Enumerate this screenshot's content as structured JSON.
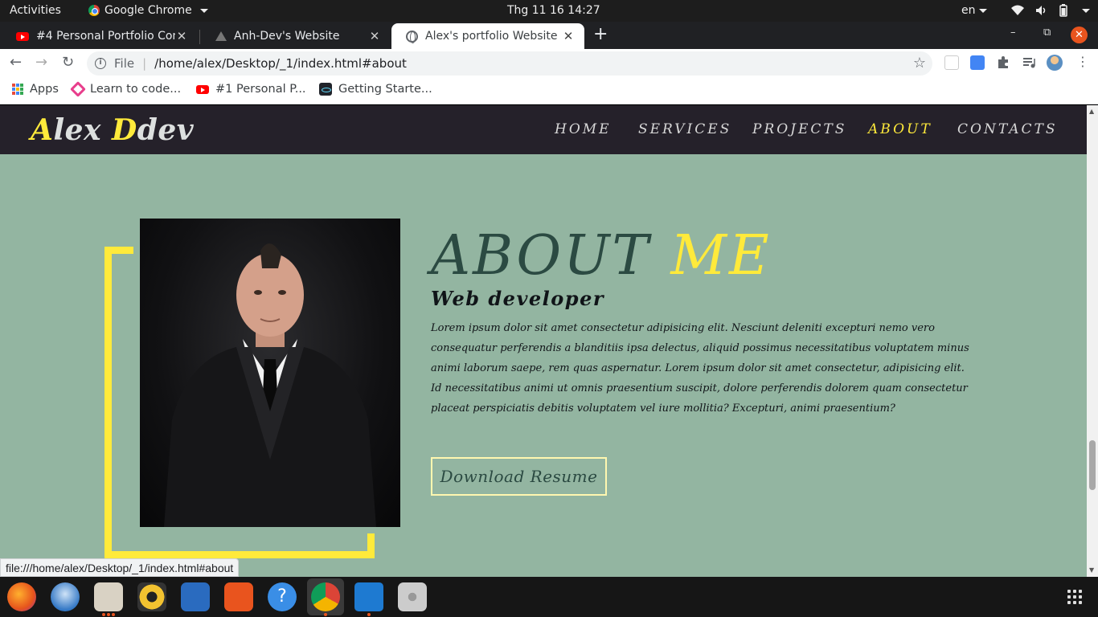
{
  "system": {
    "activities": "Activities",
    "app_name": "Google Chrome",
    "clock": "Thg 11 16  14:27",
    "lang": "en"
  },
  "tabs": [
    {
      "title": "#4 Personal Portfolio Con",
      "icon": "youtube-icon"
    },
    {
      "title": "Anh-Dev's Website",
      "icon": "triangle-icon"
    },
    {
      "title": "Alex's portfolio Website",
      "icon": "globe-icon",
      "active": true
    }
  ],
  "address": {
    "scheme_label": "File",
    "url": "/home/alex/Desktop/_1/index.html#about"
  },
  "bookmarks": [
    {
      "label": "Apps",
      "icon": "apps-grid-icon"
    },
    {
      "label": "Learn to code...",
      "icon": "freecodecamp-icon"
    },
    {
      "label": "#1 Personal P...",
      "icon": "youtube-icon"
    },
    {
      "label": "Getting Starte...",
      "icon": "react-icon"
    }
  ],
  "site": {
    "logo_first_letter": "A",
    "logo_rest_1": "lex ",
    "logo_second_letter": "D",
    "logo_rest_2": "dev",
    "nav": [
      "HOME",
      "SERVICES",
      "PROJECTS",
      "ABOUT",
      "CONTACTS"
    ],
    "active_nav": "ABOUT",
    "about_word": "ABOUT",
    "me_word": "ME",
    "subtitle": "Web developer",
    "bio": "Lorem ipsum dolor sit amet consectetur adipisicing elit. Nesciunt deleniti excepturi nemo vero consequatur perferendis a blanditiis ipsa delectus, aliquid possimus necessitatibus voluptatem minus animi laborum saepe, rem quas aspernatur. Lorem ipsum dolor sit amet consectetur, adipisicing elit. Id necessitatibus animi ut omnis praesentium suscipit, dolore perferendis dolorem quam consectetur placeat perspiciatis debitis voluptatem vel iure mollitia? Excepturi, animi praesentium?",
    "button": "Download Resume"
  },
  "status_url": "file:///home/alex/Desktop/_1/index.html#about",
  "colors": {
    "accent_yellow": "#ffea3b",
    "page_bg": "#93b5a1",
    "nav_bg": "#25212a",
    "heading": "#2b4a42"
  },
  "dock": [
    "firefox-icon",
    "thunderbird-icon",
    "files-icon",
    "rhythmbox-icon",
    "libreoffice-writer-icon",
    "software-icon",
    "help-icon",
    "chrome-icon",
    "vscode-icon",
    "disk-icon"
  ]
}
